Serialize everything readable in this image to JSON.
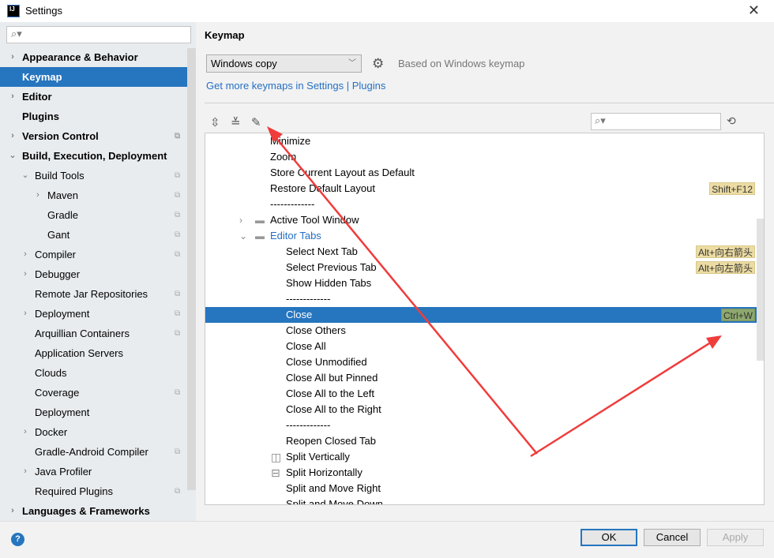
{
  "window": {
    "title": "Settings",
    "logo": "IJ",
    "close": "✕"
  },
  "sidebar": {
    "search_icon": "search-icon",
    "items": [
      {
        "label": "Appearance & Behavior",
        "level": 0,
        "bold": true,
        "arrow": "›"
      },
      {
        "label": "Keymap",
        "level": 0,
        "bold": true,
        "selected": true
      },
      {
        "label": "Editor",
        "level": 0,
        "bold": true,
        "arrow": "›"
      },
      {
        "label": "Plugins",
        "level": 0,
        "bold": true
      },
      {
        "label": "Version Control",
        "level": 0,
        "bold": true,
        "arrow": "›",
        "copy": true
      },
      {
        "label": "Build, Execution, Deployment",
        "level": 0,
        "bold": true,
        "arrow": "⌄"
      },
      {
        "label": "Build Tools",
        "level": 1,
        "arrow": "⌄",
        "copy": true
      },
      {
        "label": "Maven",
        "level": 2,
        "arrow": "›",
        "copy": true
      },
      {
        "label": "Gradle",
        "level": 2,
        "copy": true
      },
      {
        "label": "Gant",
        "level": 2,
        "copy": true
      },
      {
        "label": "Compiler",
        "level": 1,
        "arrow": "›",
        "copy": true
      },
      {
        "label": "Debugger",
        "level": 1,
        "arrow": "›"
      },
      {
        "label": "Remote Jar Repositories",
        "level": 1,
        "copy": true
      },
      {
        "label": "Deployment",
        "level": 1,
        "arrow": "›",
        "copy": true
      },
      {
        "label": "Arquillian Containers",
        "level": 1,
        "copy": true
      },
      {
        "label": "Application Servers",
        "level": 1
      },
      {
        "label": "Clouds",
        "level": 1
      },
      {
        "label": "Coverage",
        "level": 1,
        "copy": true
      },
      {
        "label": "Deployment",
        "level": 1
      },
      {
        "label": "Docker",
        "level": 1,
        "arrow": "›"
      },
      {
        "label": "Gradle-Android Compiler",
        "level": 1,
        "copy": true
      },
      {
        "label": "Java Profiler",
        "level": 1,
        "arrow": "›"
      },
      {
        "label": "Required Plugins",
        "level": 1,
        "copy": true
      },
      {
        "label": "Languages & Frameworks",
        "level": 0,
        "bold": true,
        "arrow": "›"
      }
    ]
  },
  "main": {
    "heading": "Keymap",
    "keymap_select": "Windows copy",
    "based_on": "Based on Windows keymap",
    "link": "Get more keymaps in Settings | Plugins",
    "toolbar": {
      "expand_all": "⇳",
      "collapse_all": "≚",
      "edit": "✎"
    },
    "tree": [
      {
        "label": "Minimize",
        "indent": 1
      },
      {
        "label": "Zoom",
        "indent": 1
      },
      {
        "label": "Store Current Layout as Default",
        "indent": 1
      },
      {
        "label": "Restore Default Layout",
        "indent": 1,
        "shortcut": "Shift+F12"
      },
      {
        "label": "-------------",
        "indent": 1
      },
      {
        "label": "Active Tool Window",
        "indent": 1,
        "folder": true,
        "arrow": "›"
      },
      {
        "label": "Editor Tabs",
        "indent": 1,
        "folder": true,
        "arrow": "⌄",
        "blue": true
      },
      {
        "label": "Select Next Tab",
        "indent": 2,
        "shortcut": "Alt+向右箭头"
      },
      {
        "label": "Select Previous Tab",
        "indent": 2,
        "shortcut": "Alt+向左箭头"
      },
      {
        "label": "Show Hidden Tabs",
        "indent": 2
      },
      {
        "label": "-------------",
        "indent": 2
      },
      {
        "label": "Close",
        "indent": 2,
        "shortcut": "Ctrl+W",
        "selected": true
      },
      {
        "label": "Close Others",
        "indent": 2
      },
      {
        "label": "Close All",
        "indent": 2
      },
      {
        "label": "Close Unmodified",
        "indent": 2
      },
      {
        "label": "Close All but Pinned",
        "indent": 2
      },
      {
        "label": "Close All to the Left",
        "indent": 2
      },
      {
        "label": "Close All to the Right",
        "indent": 2
      },
      {
        "label": "-------------",
        "indent": 2
      },
      {
        "label": "Reopen Closed Tab",
        "indent": 2
      },
      {
        "label": "Split Vertically",
        "indent": 2,
        "icon": "◫"
      },
      {
        "label": "Split Horizontally",
        "indent": 2,
        "icon": "⊟"
      },
      {
        "label": "Split and Move Right",
        "indent": 2
      },
      {
        "label": "Split and Move Down",
        "indent": 2
      }
    ]
  },
  "footer": {
    "help": "?",
    "ok": "OK",
    "cancel": "Cancel",
    "apply": "Apply"
  },
  "annotation_color": "#f03c3c"
}
